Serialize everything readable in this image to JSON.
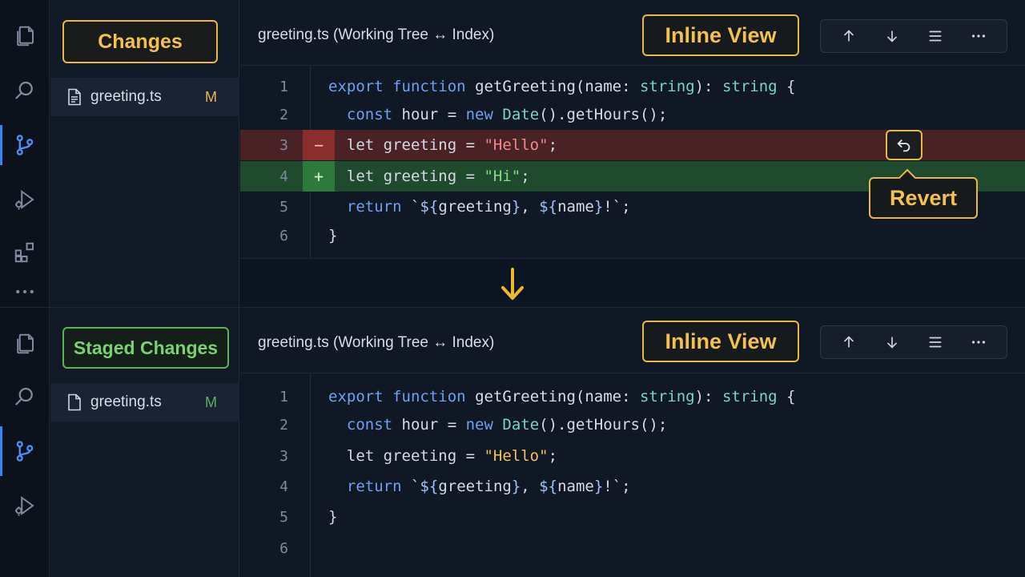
{
  "colors": {
    "accent": "#3b82f6",
    "highlight": "#e8b93e",
    "staged": "#5fae5a",
    "deleted_bg": "#4a2125",
    "added_bg": "#1f4a2d"
  },
  "top": {
    "activity_icons": [
      "files-icon",
      "search-icon",
      "source-control-icon",
      "run-debug-icon",
      "extensions-icon",
      "more-icon"
    ],
    "sidebar": {
      "section_label": "Changes",
      "file": {
        "name": "greeting.ts",
        "status": "M",
        "status_color": "#e8b93e"
      }
    },
    "editor": {
      "title": "greeting.ts (Working Tree ↔ Index)",
      "view_label": "Inline View",
      "toolbar": [
        "arrow-up-icon",
        "arrow-down-icon",
        "list-icon",
        "more-icon"
      ],
      "lines": [
        {
          "num": "1",
          "kind": "normal"
        },
        {
          "num": "2",
          "kind": "normal"
        },
        {
          "num": "3",
          "kind": "deleted",
          "marker": "−"
        },
        {
          "num": "4",
          "kind": "added",
          "marker": "+"
        },
        {
          "num": "5",
          "kind": "normal"
        },
        {
          "num": "6",
          "kind": "normal"
        }
      ],
      "revert_label": "Revert"
    }
  },
  "bottom": {
    "activity_icons": [
      "files-icon",
      "search-icon",
      "source-control-icon",
      "run-debug-icon"
    ],
    "sidebar": {
      "section_label": "Staged Changes",
      "file": {
        "name": "greeting.ts",
        "status": "M",
        "status_color": "#5fae5a"
      }
    },
    "editor": {
      "title": "greeting.ts (Working Tree ↔ Index)",
      "view_label": "Inline View",
      "toolbar": [
        "arrow-up-icon",
        "arrow-down-icon",
        "list-icon",
        "more-icon"
      ],
      "lines": [
        {
          "num": "1"
        },
        {
          "num": "2"
        },
        {
          "num": "3"
        },
        {
          "num": "4"
        },
        {
          "num": "5"
        },
        {
          "num": "6"
        }
      ]
    }
  },
  "code": {
    "l1": {
      "export": "export",
      "function": "function",
      "name": "getGreeting(name: ",
      "type1": "string",
      "mid": "): ",
      "type2": "string",
      "end": " {"
    },
    "l2": {
      "indent": "  ",
      "const": "const",
      "rest1": " hour = ",
      "new": "new",
      "rest2": " ",
      "date": "Date",
      "rest3": "().getHours();"
    },
    "l3_del": {
      "indent": "  ",
      "text1": "let greeting = ",
      "str": "\"Hello\"",
      "end": ";"
    },
    "l4_add": {
      "indent": "  ",
      "text1": "let greeting = ",
      "str": "\"Hi\"",
      "end": ";"
    },
    "l5": {
      "indent": "  ",
      "return": "return",
      "tick": " `",
      "i1": "${",
      "v1": "greeting",
      "c1": "}",
      "sep": ", ",
      "i2": "${",
      "v2": "name",
      "c2": "}",
      "tail": "!`;"
    },
    "l6": {
      "brace": "}"
    },
    "b3": {
      "indent": "  ",
      "text1": "let greeting = ",
      "str": "\"Hello\"",
      "end": ";"
    },
    "b4": {
      "indent": "  ",
      "return": "return",
      "tick": " `",
      "i1": "${",
      "v1": "greeting",
      "c1": "}",
      "sep": ", ",
      "i2": "${",
      "v2": "name",
      "c2": "}",
      "tail": "!`;"
    },
    "b5": {
      "brace": "}"
    }
  }
}
